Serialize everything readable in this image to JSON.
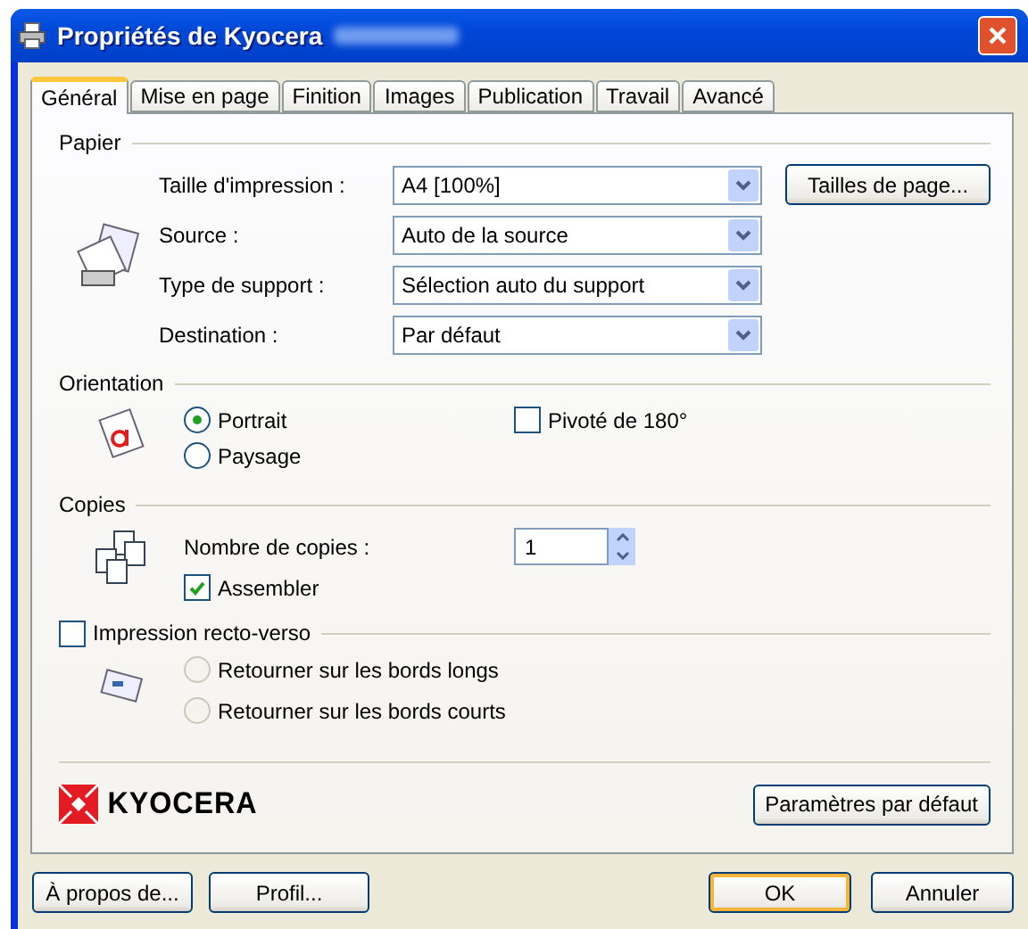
{
  "window": {
    "title": "Propriétés de Kyocera"
  },
  "tabs": [
    {
      "label": "Général",
      "selected": true
    },
    {
      "label": "Mise en page",
      "selected": false
    },
    {
      "label": "Finition",
      "selected": false
    },
    {
      "label": "Images",
      "selected": false
    },
    {
      "label": "Publication",
      "selected": false
    },
    {
      "label": "Travail",
      "selected": false
    },
    {
      "label": "Avancé",
      "selected": false
    }
  ],
  "paper": {
    "heading": "Papier",
    "fields": [
      {
        "label": "Taille d'impression :",
        "value": "A4  [100%]"
      },
      {
        "label": "Source :",
        "value": "Auto de la source"
      },
      {
        "label": "Type de support :",
        "value": "Sélection auto du support"
      },
      {
        "label": "Destination :",
        "value": "Par défaut"
      }
    ],
    "page_sizes_button": "Tailles de page..."
  },
  "orientation": {
    "heading": "Orientation",
    "options": [
      {
        "label": "Portrait",
        "selected": true
      },
      {
        "label": "Paysage",
        "selected": false
      }
    ],
    "rotate": {
      "label": "Pivoté de 180°",
      "checked": false
    }
  },
  "copies": {
    "heading": "Copies",
    "count_label": "Nombre de copies :",
    "count": "1",
    "collate": {
      "label": "Assembler",
      "checked": true
    }
  },
  "duplex": {
    "label": "Impression recto-verso",
    "checked": false,
    "options": [
      {
        "label": "Retourner sur les bords longs",
        "selected": false,
        "disabled": true
      },
      {
        "label": "Retourner sur les bords courts",
        "selected": false,
        "disabled": true
      }
    ]
  },
  "logo": "KYOCERA",
  "defaults_button": "Paramètres par défaut",
  "footer": {
    "left": [
      {
        "label": "À propos de...",
        "default": false
      },
      {
        "label": "Profil...",
        "default": false
      }
    ],
    "right": [
      {
        "label": "OK",
        "default": true
      },
      {
        "label": "Annuler",
        "default": false
      }
    ]
  }
}
